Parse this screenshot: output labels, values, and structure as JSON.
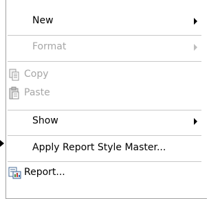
{
  "menu": {
    "items": [
      {
        "label": "New",
        "enabled": true,
        "submenu": true
      },
      {
        "label": "Format",
        "enabled": false,
        "submenu": true
      },
      {
        "label": "Copy",
        "enabled": false,
        "icon": "copy-icon"
      },
      {
        "label": "Paste",
        "enabled": false,
        "icon": "paste-icon"
      },
      {
        "label": "Show",
        "enabled": true,
        "submenu": true
      },
      {
        "label": "Apply Report Style Master...",
        "enabled": true
      },
      {
        "label": "Report...",
        "enabled": true,
        "icon": "report-icon"
      }
    ]
  },
  "colors": {
    "enabled_text": "#000000",
    "disabled_text": "#a6a6a6",
    "separator": "#c8c8c8"
  }
}
